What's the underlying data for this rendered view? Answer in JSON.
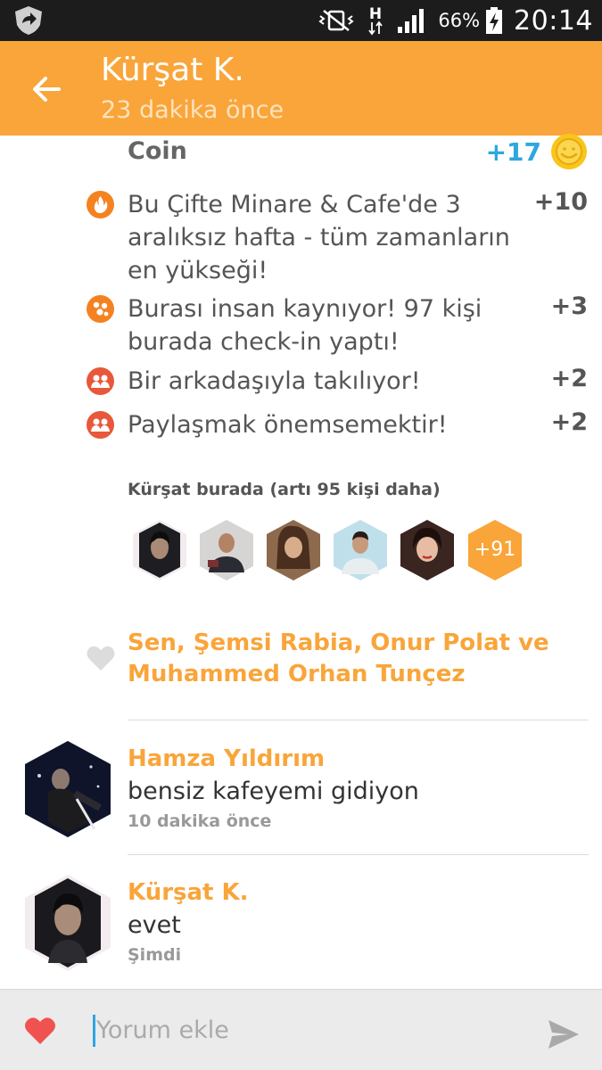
{
  "status_bar": {
    "battery_percent": "66%",
    "time": "20:14",
    "network_label": "H"
  },
  "header": {
    "title": "Kürşat K.",
    "subtitle": "23 dakika önce"
  },
  "coins": {
    "label": "Coin",
    "total": "+17",
    "bonuses": [
      {
        "icon": "flame-icon",
        "text": "Bu Çifte Minare & Cafe'de 3 aralıksız hafta - tüm zamanların en yükseği!",
        "points": "+10"
      },
      {
        "icon": "crowd-icon",
        "text": "Burası insan kaynıyor! 97 kişi burada check-in yaptı!",
        "points": "+3"
      },
      {
        "icon": "friends-icon",
        "text": "Bir arkadaşıyla takılıyor!",
        "points": "+2"
      },
      {
        "icon": "friends-icon",
        "text": "Paylaşmak önemsemektir!",
        "points": "+2"
      }
    ]
  },
  "here": {
    "label": "Kürşat burada (artı 95 kişi daha)",
    "more_count": "+91"
  },
  "likes": {
    "text": "Sen, Şemsi Rabia, Onur Polat ve Muhammed Orhan Tunçez"
  },
  "comments": [
    {
      "name": "Hamza Yıldırım",
      "text": "bensiz kafeyemi gidiyon",
      "time": "10 dakika önce"
    },
    {
      "name": "Kürşat K.",
      "text": "evet",
      "time": "Şimdi"
    }
  ],
  "input": {
    "placeholder": "Yorum ekle"
  },
  "colors": {
    "accent": "#f9a53a",
    "coin_blue": "#2fa6e0",
    "bonus_orange": "#f58220",
    "friends_red": "#e8583a",
    "heart_red": "#f0524f"
  }
}
